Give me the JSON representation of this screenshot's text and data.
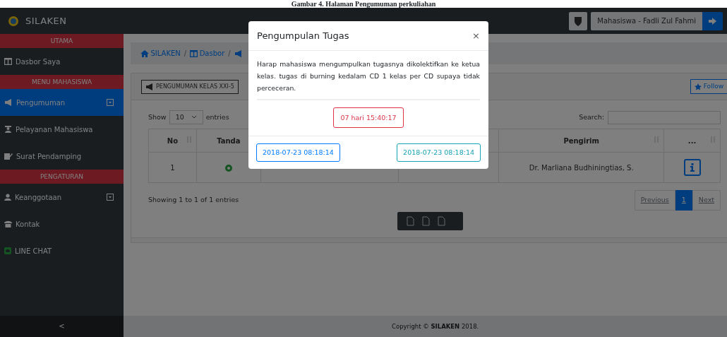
{
  "caption": "Gambar 4. Halaman Pengumuman perkuliahan",
  "brand": "SILAKEN",
  "user": {
    "label": "Mahasiswa - Fadli Zul Fahmi"
  },
  "sidebar": [
    {
      "kind": "header",
      "label": "UTAMA"
    },
    {
      "kind": "item",
      "label": "Dasbor Saya",
      "selected": false,
      "dropdown": false
    },
    {
      "kind": "header",
      "label": "MENU MAHASISWA"
    },
    {
      "kind": "item",
      "label": "Pengumuman",
      "selected": true,
      "dropdown": true
    },
    {
      "kind": "item",
      "label": "Pelayanan Mahasiswa",
      "selected": false,
      "dropdown": false
    },
    {
      "kind": "item",
      "label": "Surat Pendamping",
      "selected": false,
      "dropdown": false
    },
    {
      "kind": "header",
      "label": "PENGATURAN"
    },
    {
      "kind": "item",
      "label": "Keanggotaan",
      "selected": false,
      "dropdown": true
    },
    {
      "kind": "item",
      "label": "Kontak",
      "selected": false,
      "dropdown": false
    },
    {
      "kind": "item",
      "label": "LINE CHAT",
      "selected": false,
      "dropdown": false
    }
  ],
  "sidebar_toggle": "<",
  "breadcrumb": [
    {
      "label": "SILAKEN"
    },
    {
      "separator": "/",
      "label": "Dasbor"
    },
    {
      "separator": "/"
    }
  ],
  "card": {
    "tag_button": "PENGUMUMAN KELAS XXI-5",
    "follow_button": "Follow"
  },
  "table": {
    "show_label": "Show",
    "entries_value": "10",
    "entries_label": "entries",
    "search_label": "Search:",
    "columns": [
      {
        "label": "No",
        "sort_arrows": true
      },
      {
        "label": "Tanda"
      },
      {},
      {},
      {
        "label": "Pengirim",
        "sort_arrows": true
      },
      {
        "label": "...",
        "sort_arrows": true
      }
    ],
    "rows": [
      {
        "no": "1",
        "pengirim": "Dr. Marliana Budhiningtias, S."
      }
    ],
    "info": "Showing 1 to 1 of 1 entries",
    "pagination": [
      {
        "label": "Previous",
        "selected": false
      },
      {
        "label": "1",
        "selected": true
      },
      {
        "label": "Next",
        "selected": false
      }
    ]
  },
  "footer": "Copyright © **SILAKEN** 2018.",
  "modal": {
    "title": "Pengumpulan Tugas",
    "close": "×",
    "body": "Harap mahasiswa mengumpulkan tugasnya dikolektifkan ke ketua kelas. tugas di burning kedalam CD 1 kelas per CD supaya tidak perceceran.",
    "countdown": "07 hari 15:40:17",
    "buttons": [
      {
        "kind": "primary",
        "label": "2018-07-23 08:18:14"
      },
      {
        "kind": "info",
        "label": "2018-07-23 08:18:14"
      }
    ]
  }
}
